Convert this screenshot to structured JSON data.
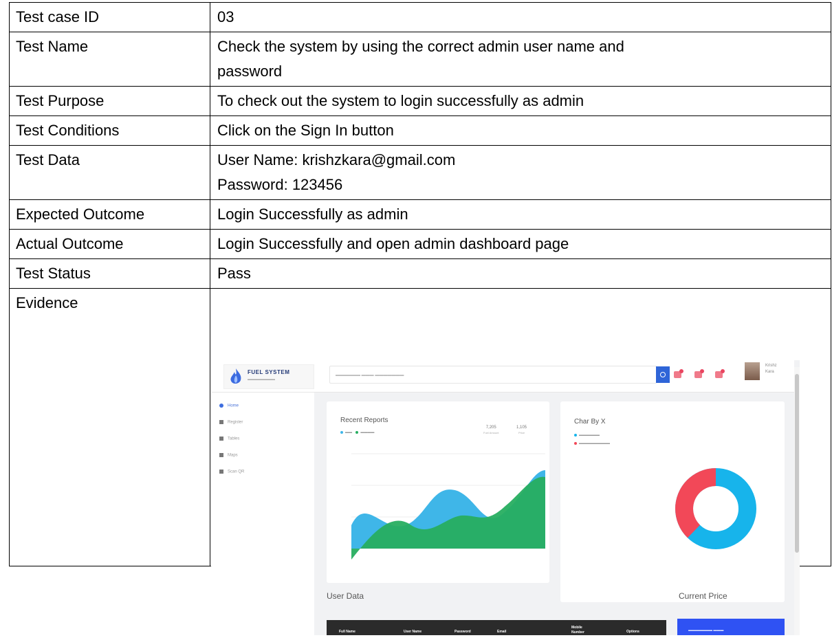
{
  "rows": [
    {
      "label": "Test case ID",
      "value": "03"
    },
    {
      "label": "Test Name",
      "value": "Check the system by using the correct admin user name and",
      "value2": "password"
    },
    {
      "label": "Test Purpose",
      "value": "To check out the system to login successfully as admin"
    },
    {
      "label": "Test Conditions",
      "value": "Click on the Sign In button"
    },
    {
      "label": "Test Data",
      "value": "User Name: krishzkara@gmail.com",
      "value2": "Password: 123456"
    },
    {
      "label": "Expected Outcome",
      "value": "Login Successfully as admin"
    },
    {
      "label": "Actual Outcome",
      "value": "Login Successfully and open admin dashboard page"
    },
    {
      "label": "Test Status",
      "value": "Pass"
    },
    {
      "label": "Evidence"
    }
  ],
  "evidence": {
    "logo": {
      "name": "FUEL SYSTEM"
    },
    "user": {
      "name": "Krishz",
      "sub": "Kara"
    },
    "nav": [
      "Home",
      "Register",
      "Tables",
      "Maps",
      "Scan QR"
    ],
    "recent_reports": {
      "title": "Recent Reports",
      "stat1_value": "7,205",
      "stat1_label": "Fuel Amount",
      "stat2_value": "1,105",
      "stat2_label": "Price"
    },
    "donut": {
      "title": "Char By X"
    },
    "user_data": {
      "title": "User Data",
      "columns": [
        "Full Name",
        "User Name",
        "Password",
        "Email",
        "Mobile Number",
        "Options"
      ]
    },
    "current_price": {
      "title": "Current Price"
    },
    "colors": {
      "accent": "#2f65d8",
      "area_blue": "#3fb6e8",
      "area_green": "#27ae60",
      "donut_red": "#f24858",
      "donut_blue": "#17b4eb"
    }
  }
}
